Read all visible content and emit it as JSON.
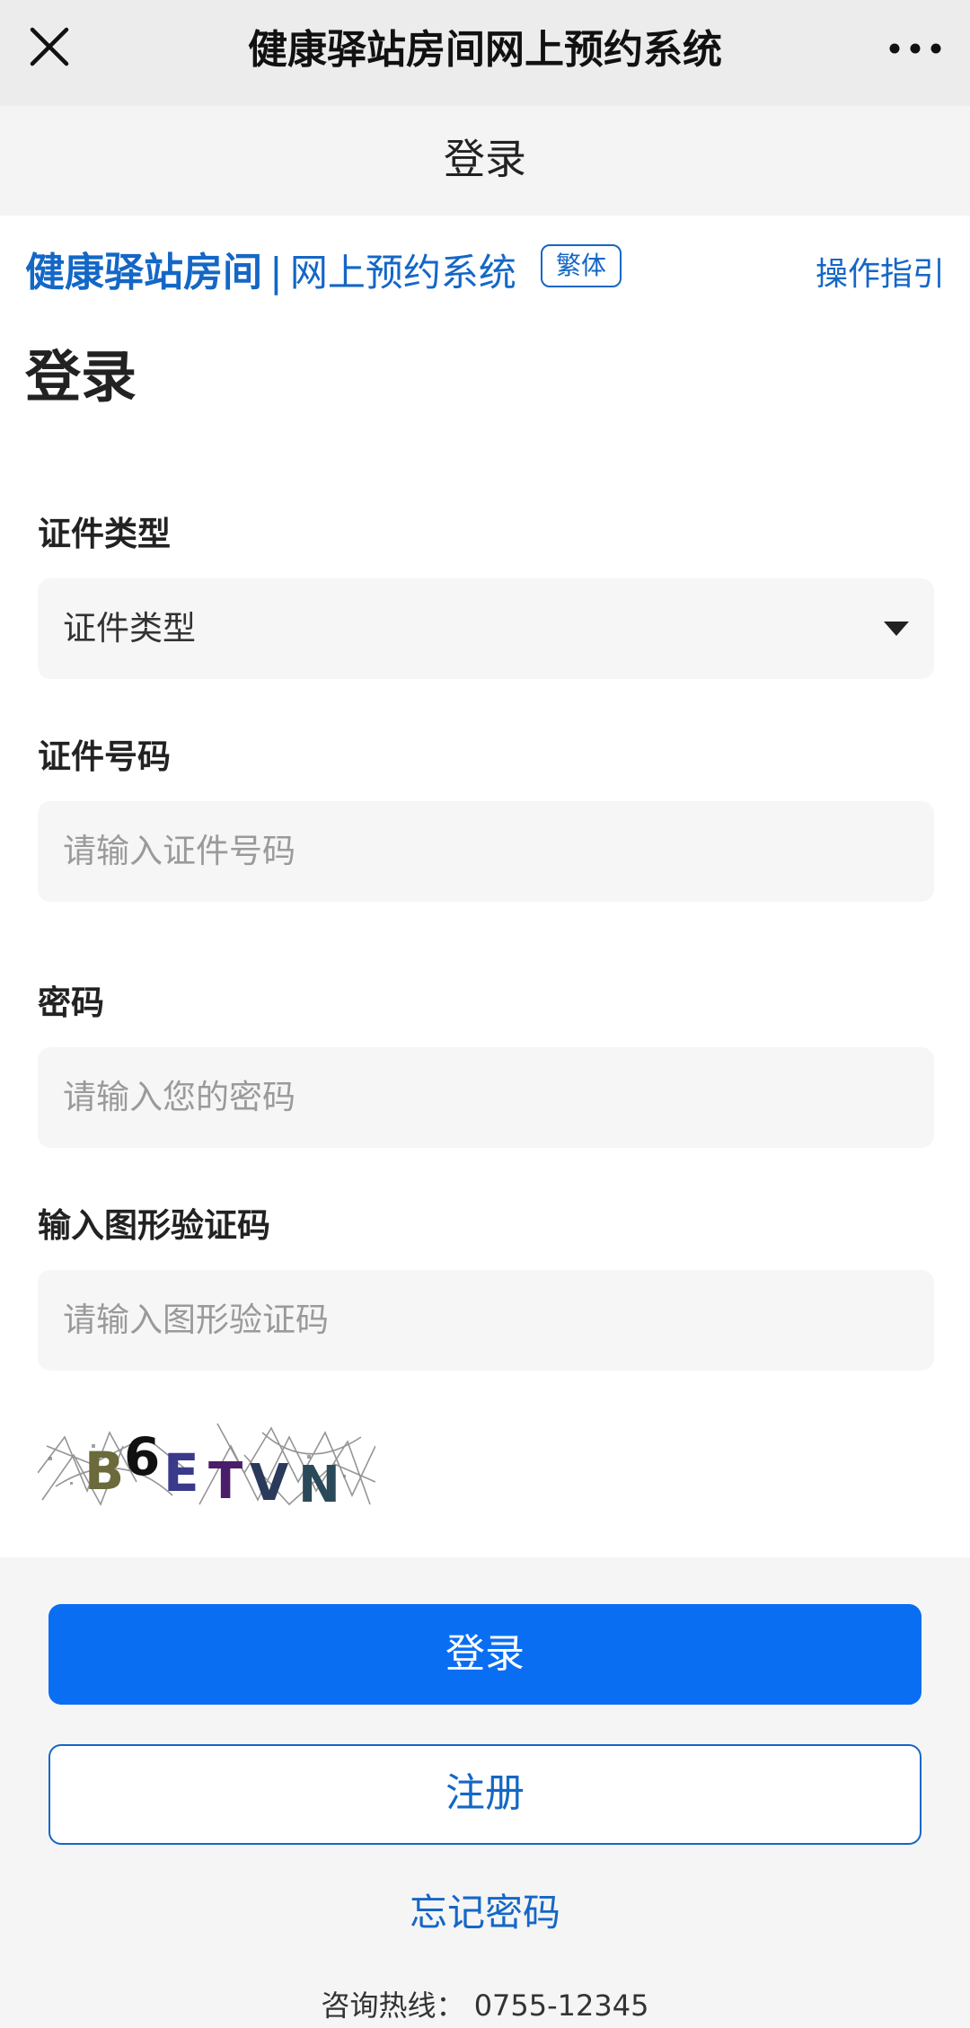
{
  "topbar": {
    "title": "健康驿站房间网上预约系统",
    "close_icon": "close-icon",
    "more_icon": "more-dots-icon"
  },
  "subheader": {
    "title": "登录"
  },
  "brand": {
    "name": "健康驿站房间",
    "separator": "|",
    "system": "网上预约系统",
    "lang_toggle": "繁体",
    "guide_link": "操作指引"
  },
  "page": {
    "title": "登录"
  },
  "form": {
    "id_type": {
      "label": "证件类型",
      "selected": "证件类型"
    },
    "id_number": {
      "label": "证件号码",
      "placeholder": "请输入证件号码"
    },
    "password": {
      "label": "密码",
      "placeholder": "请输入您的密码"
    },
    "captcha_input": {
      "label": "输入图形验证码",
      "placeholder": "请输入图形验证码"
    },
    "captcha_image": {
      "text": "B6ETVN"
    }
  },
  "actions": {
    "login_label": "登录",
    "register_label": "注册",
    "forgot_label": "忘记密码"
  },
  "footer": {
    "hotline": "咨询热线： 0755-12345"
  },
  "colors": {
    "brand_blue": "#1467c6",
    "primary_button": "#0a6ef3"
  }
}
